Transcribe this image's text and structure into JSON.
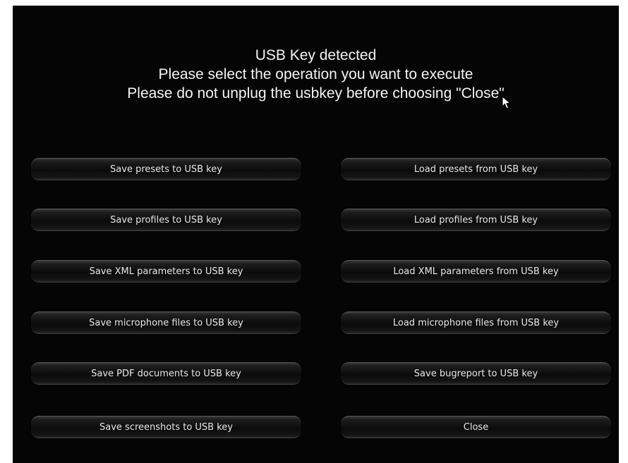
{
  "dialog": {
    "title": "USB Key detected",
    "subtitle": "Please select the operation you want to execute",
    "warning": "Please do not unplug the usbkey before choosing \"Close\""
  },
  "buttons": {
    "save_presets": "Save presets to USB key",
    "load_presets": "Load presets from USB key",
    "save_profiles": "Save profiles to USB key",
    "load_profiles": "Load profiles from USB key",
    "save_xml": "Save XML parameters to USB key",
    "load_xml": "Load XML parameters from USB key",
    "save_microphone": "Save microphone files to USB key",
    "load_microphone": "Load microphone files from USB key",
    "save_pdf": "Save PDF documents to USB key",
    "save_bugreport": "Save bugreport to USB key",
    "save_screenshots": "Save screenshots to USB key",
    "close": "Close"
  },
  "colors": {
    "background": "#050505",
    "text": "#f4f4f4",
    "button_text": "#e8e8e8"
  },
  "icons": {
    "cursor": "mouse-pointer-icon"
  }
}
